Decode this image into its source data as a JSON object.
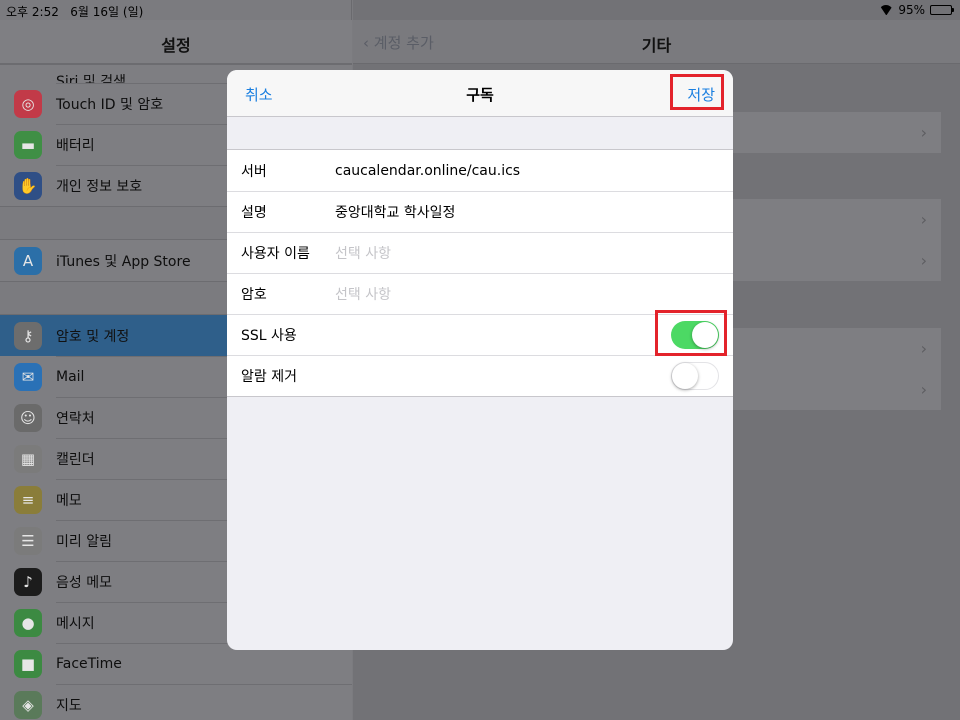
{
  "status_bar": {
    "time": "오후 2:52",
    "date": "6월 16일 (일)",
    "battery": "95%",
    "battery_level": 0.95
  },
  "left_pane": {
    "title": "설정",
    "partial_item": "Siri 및 검색",
    "groups": [
      [
        {
          "label": "Touch ID 및 암호",
          "icon": "fingerprint-icon",
          "color": "#c23a48"
        },
        {
          "label": "배터리",
          "icon": "battery-icon",
          "color": "#3f8f45"
        },
        {
          "label": "개인 정보 보호",
          "icon": "hand-icon",
          "color": "#2f4f86"
        }
      ],
      [
        {
          "label": "iTunes 및 App Store",
          "icon": "app-store-icon",
          "color": "#2b6fa8"
        }
      ],
      [
        {
          "label": "암호 및 계정",
          "icon": "key-icon",
          "color": "#6d6d6d",
          "selected": true
        },
        {
          "label": "Mail",
          "icon": "mail-icon",
          "color": "#2a71b6"
        },
        {
          "label": "연락처",
          "icon": "contacts-icon",
          "color": "#6a6a6a"
        },
        {
          "label": "캘린더",
          "icon": "calendar-icon",
          "color": "#7b7b7b"
        },
        {
          "label": "메모",
          "icon": "notes-icon",
          "color": "#8a7d3a"
        },
        {
          "label": "미리 알림",
          "icon": "reminders-icon",
          "color": "#7b7b7b"
        },
        {
          "label": "음성 메모",
          "icon": "voice-memo-icon",
          "color": "#1c1c1c"
        },
        {
          "label": "메시지",
          "icon": "messages-icon",
          "color": "#3c8a42"
        },
        {
          "label": "FaceTime",
          "icon": "facetime-icon",
          "color": "#3c8a42"
        },
        {
          "label": "지도",
          "icon": "maps-icon",
          "color": "#5a7a5a"
        }
      ]
    ]
  },
  "right_pane": {
    "back_label": "계정 추가",
    "title": "기타"
  },
  "modal": {
    "cancel_label": "취소",
    "title": "구독",
    "save_label": "저장",
    "fields": {
      "server": {
        "label": "서버",
        "value": "caucalendar.online/cau.ics"
      },
      "description": {
        "label": "설명",
        "value": "중앙대학교 학사일정"
      },
      "username": {
        "label": "사용자 이름",
        "placeholder": "선택 사항"
      },
      "password": {
        "label": "암호",
        "placeholder": "선택 사항"
      },
      "ssl": {
        "label": "SSL 사용",
        "on": true
      },
      "remove_alarms": {
        "label": "알람 제거",
        "on": false
      }
    }
  },
  "colors": {
    "accent": "#1a7fe0",
    "toggle_on": "#4cd964",
    "highlight": "#e3232b"
  }
}
